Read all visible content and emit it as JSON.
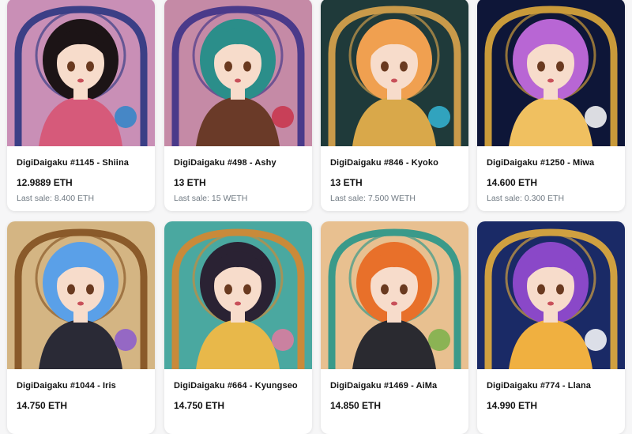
{
  "items": [
    {
      "name": "DigiDaigaku #1145 - Shiina",
      "price": "12.9889 ETH",
      "last_sale": "Last sale: 8.400 ETH",
      "colors": {
        "bg": "#c98fb6",
        "frame": "#3b3f86",
        "hair": "#1c1416",
        "skin": "#f7dccb",
        "outfit": "#d65a7a",
        "accent": "#2f86c9"
      }
    },
    {
      "name": "DigiDaigaku #498 - Ashy",
      "price": "13 ETH",
      "last_sale": "Last sale: 15 WETH",
      "colors": {
        "bg": "#c58aa6",
        "frame": "#4a3a8a",
        "hair": "#2b8e8a",
        "skin": "#f7dccb",
        "outfit": "#6a3a28",
        "accent": "#c8324a"
      }
    },
    {
      "name": "DigiDaigaku #846 - Kyoko",
      "price": "13 ETH",
      "last_sale": "Last sale: 7.500 WETH",
      "colors": {
        "bg": "#1f3a3a",
        "frame": "#c99a4a",
        "hair": "#f0a050",
        "skin": "#f7dccb",
        "outfit": "#d9a84a",
        "accent": "#35b6d6"
      }
    },
    {
      "name": "DigiDaigaku #1250 - Miwa",
      "price": "14.600 ETH",
      "last_sale": "Last sale: 0.300 ETH",
      "colors": {
        "bg": "#0e1638",
        "frame": "#c99a3a",
        "hair": "#b866d4",
        "skin": "#f7dccb",
        "outfit": "#f0c060",
        "accent": "#ffffff"
      }
    },
    {
      "name": "DigiDaigaku #1044 - Iris",
      "price": "14.750 ETH",
      "last_sale": "",
      "colors": {
        "bg": "#d4b583",
        "frame": "#8a5a2a",
        "hair": "#5aa0e8",
        "skin": "#f7dccb",
        "outfit": "#2a2a36",
        "accent": "#8a5ad0"
      }
    },
    {
      "name": "DigiDaigaku #664 - Kyungseo",
      "price": "14.750 ETH",
      "last_sale": "",
      "colors": {
        "bg": "#4aa8a0",
        "frame": "#c98a3a",
        "hair": "#2a2233",
        "skin": "#f7dccb",
        "outfit": "#e8b84a",
        "accent": "#e07aa0"
      }
    },
    {
      "name": "DigiDaigaku #1469 - AiMa",
      "price": "14.850 ETH",
      "last_sale": "",
      "colors": {
        "bg": "#e8c090",
        "frame": "#3a9a8a",
        "hair": "#e8702a",
        "skin": "#f7dccb",
        "outfit": "#2a2a30",
        "accent": "#7ab04a"
      }
    },
    {
      "name": "DigiDaigaku #774 - Llana",
      "price": "14.990 ETH",
      "last_sale": "",
      "colors": {
        "bg": "#1a2a66",
        "frame": "#d0a040",
        "hair": "#8a48c8",
        "skin": "#f7dccb",
        "outfit": "#f0b040",
        "accent": "#ffffff"
      }
    }
  ]
}
